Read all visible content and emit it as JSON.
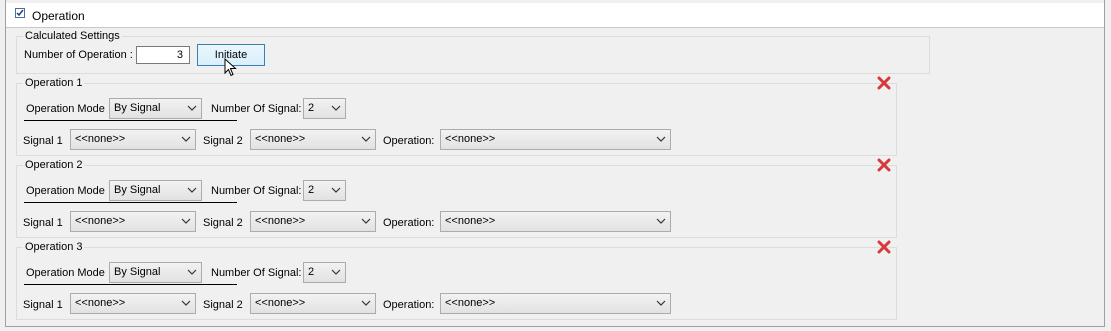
{
  "section": {
    "title": "Operation",
    "checked": true
  },
  "calculated": {
    "title": "Calculated Settings",
    "num_label": "Number of Operation :",
    "num_value": "3",
    "initiate_label": "Initiate"
  },
  "operations": [
    {
      "title": "Operation 1",
      "mode_label": "Operation Mode",
      "mode_value": "By Signal",
      "num_signal_label": "Number Of Signal:",
      "num_signal_value": "2",
      "signal1_label": "Signal 1",
      "signal1_value": "<<none>>",
      "signal2_label": "Signal 2",
      "signal2_value": "<<none>>",
      "op_label": "Operation:",
      "op_value": "<<none>>"
    },
    {
      "title": "Operation 2",
      "mode_label": "Operation Mode",
      "mode_value": "By Signal",
      "num_signal_label": "Number Of Signal:",
      "num_signal_value": "2",
      "signal1_label": "Signal 1",
      "signal1_value": "<<none>>",
      "signal2_label": "Signal 2",
      "signal2_value": "<<none>>",
      "op_label": "Operation:",
      "op_value": "<<none>>"
    },
    {
      "title": "Operation 3",
      "mode_label": "Operation Mode",
      "mode_value": "By Signal",
      "num_signal_label": "Number Of Signal:",
      "num_signal_value": "2",
      "signal1_label": "Signal 1",
      "signal1_value": "<<none>>",
      "signal2_label": "Signal 2",
      "signal2_value": "<<none>>",
      "op_label": "Operation:",
      "op_value": "<<none>>"
    }
  ],
  "icons": {
    "checkbox": "checkbox-checked-icon",
    "close": "red-x-icon",
    "dropdown": "chevron-down-icon",
    "cursor": "mouse-pointer-icon"
  },
  "colors": {
    "close_red": "#d9383a",
    "button_border": "#3c7fb1"
  }
}
